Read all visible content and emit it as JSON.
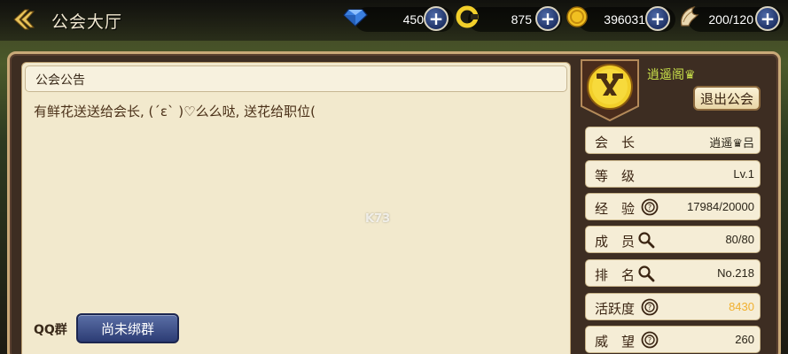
{
  "header": {
    "title": "公会大厅"
  },
  "resources": {
    "diamond": "450",
    "coupon": "875",
    "gold": "396031",
    "stamina": "200/120"
  },
  "notice": {
    "title": "公会公告",
    "text": "有鲜花送送给会长, (´ε` )♡么么哒, 送花给职位("
  },
  "qq": {
    "label": "QQ群",
    "button": "尚未绑群"
  },
  "guild": {
    "name": "逍遥阁♛",
    "quit_button": "退出公会"
  },
  "info_rows": [
    {
      "label": "会　长",
      "value": "逍遥♛吕"
    },
    {
      "label": "等　级",
      "value": "Lv.1"
    },
    {
      "label": "经　验",
      "value": "17984/20000"
    },
    {
      "label": "成　员",
      "value": "80/80"
    },
    {
      "label": "排　名",
      "value": "No.218"
    },
    {
      "label": "活跃度",
      "value": "8430"
    },
    {
      "label": "威　望",
      "value": "260"
    }
  ],
  "colors": {
    "guild_name": "#c9e04a",
    "activity_value": "#f0b030",
    "qq_button": "#3a4c88"
  },
  "watermark": "K73"
}
